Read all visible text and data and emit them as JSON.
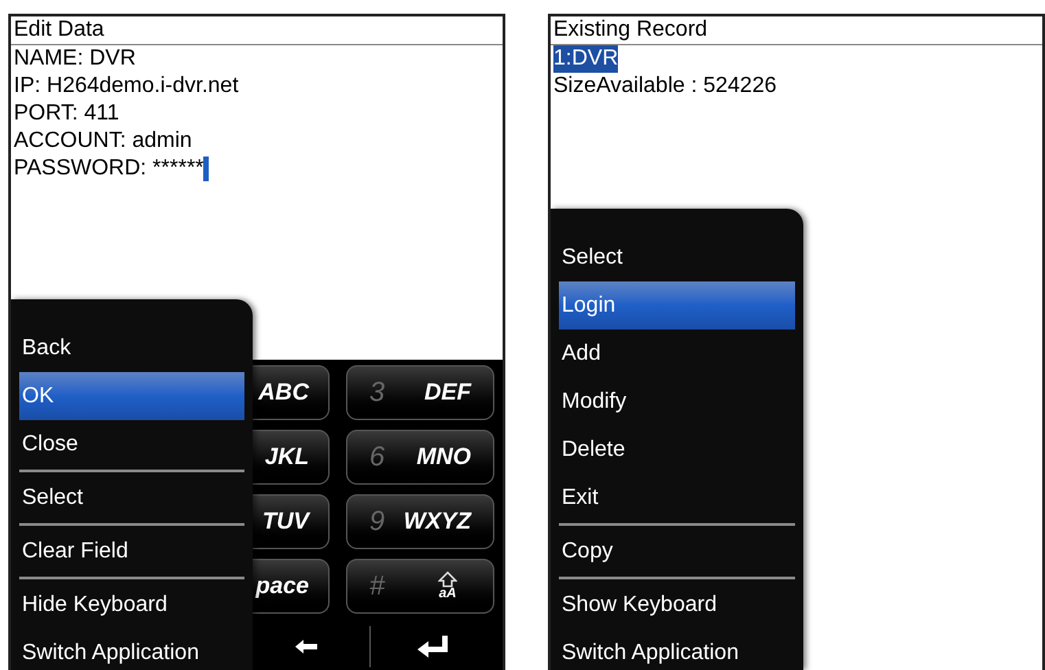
{
  "screens": [
    {
      "title": "Edit Data",
      "lines": [
        {
          "text": "NAME: DVR",
          "selected": false,
          "cursor": false
        },
        {
          "text": "IP: H264demo.i-dvr.net",
          "selected": false,
          "cursor": false
        },
        {
          "text": "PORT: 411",
          "selected": false,
          "cursor": false
        },
        {
          "text": "ACCOUNT: admin",
          "selected": false,
          "cursor": false
        },
        {
          "text": "PASSWORD: ******",
          "selected": false,
          "cursor": true
        }
      ],
      "keyboard": {
        "rows": [
          {
            "keys": [
              {
                "kind": "letters",
                "label": "ABC"
              },
              {
                "kind": "digit",
                "digit": "3",
                "label": "DEF"
              }
            ]
          },
          {
            "keys": [
              {
                "kind": "letters",
                "label": "JKL"
              },
              {
                "kind": "digit",
                "digit": "6",
                "label": "MNO"
              }
            ]
          },
          {
            "keys": [
              {
                "kind": "letters",
                "label": "TUV"
              },
              {
                "kind": "digit",
                "digit": "9",
                "label": "WXYZ"
              }
            ]
          },
          {
            "keys": [
              {
                "kind": "letters",
                "label": "pace"
              },
              {
                "kind": "shift",
                "digit": "#",
                "label": "aA"
              }
            ]
          }
        ]
      },
      "menu": [
        {
          "label": "Back",
          "selected": false,
          "divider_after": false
        },
        {
          "label": "OK",
          "selected": true,
          "divider_after": false
        },
        {
          "label": "Close",
          "selected": false,
          "divider_after": true
        },
        {
          "label": "Select",
          "selected": false,
          "divider_after": true
        },
        {
          "label": "Clear Field",
          "selected": false,
          "divider_after": true
        },
        {
          "label": "Hide Keyboard",
          "selected": false,
          "divider_after": false
        },
        {
          "label": "Switch Application",
          "selected": false,
          "divider_after": false
        }
      ]
    },
    {
      "title": "Existing Record",
      "lines": [
        {
          "text": "1:DVR",
          "selected": true,
          "cursor": false
        },
        {
          "text": "SizeAvailable : 524226",
          "selected": false,
          "cursor": false
        }
      ],
      "menu": [
        {
          "label": "Select",
          "selected": false,
          "divider_after": false
        },
        {
          "label": "Login",
          "selected": true,
          "divider_after": false
        },
        {
          "label": "Add",
          "selected": false,
          "divider_after": false
        },
        {
          "label": "Modify",
          "selected": false,
          "divider_after": false
        },
        {
          "label": "Delete",
          "selected": false,
          "divider_after": false
        },
        {
          "label": "Exit",
          "selected": false,
          "divider_after": true
        },
        {
          "label": "Copy",
          "selected": false,
          "divider_after": true
        },
        {
          "label": "Show Keyboard",
          "selected": false,
          "divider_after": false
        },
        {
          "label": "Switch Application",
          "selected": false,
          "divider_after": false
        }
      ]
    }
  ]
}
